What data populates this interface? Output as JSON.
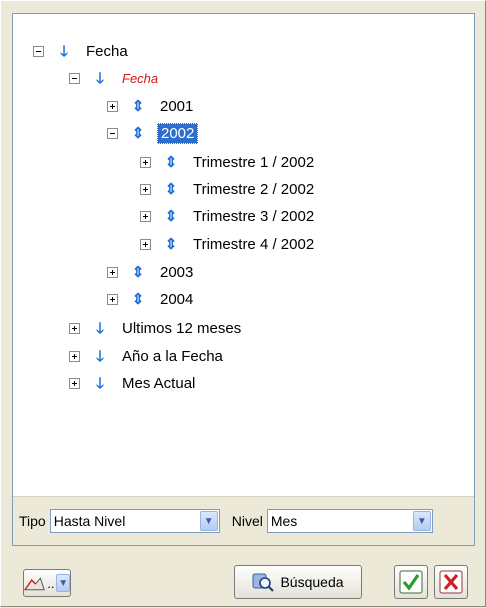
{
  "tree": {
    "root": "Fecha",
    "hierarchy": "Fecha",
    "years": [
      "2001",
      "2002",
      "2003",
      "2004"
    ],
    "quarters": [
      "Trimestre 1 / 2002",
      "Trimestre 2 / 2002",
      "Trimestre 3 / 2002",
      "Trimestre 4 / 2002"
    ],
    "others": [
      "Ultimos 12 meses",
      "Año a la Fecha",
      "Mes Actual"
    ]
  },
  "filter": {
    "tipo_label": "Tipo",
    "tipo_value": "Hasta Nivel",
    "nivel_label": "Nivel",
    "nivel_value": "Mes"
  },
  "buttons": {
    "chart_label": "..",
    "search_label": "Búsqueda"
  },
  "icons": {
    "expand": "plus-box-icon",
    "collapse": "minus-box-icon",
    "node": "arrow-down-icon",
    "member": "arrow-updown-icon",
    "search": "search-icon",
    "ok": "check-icon",
    "cancel": "x-icon"
  },
  "colors": {
    "selection": "#2a6fd0",
    "node_arrow": "#1a6fd6",
    "italic_label": "#d01a1a",
    "ok_green": "#2a9a2a",
    "cancel_red": "#d02020"
  }
}
